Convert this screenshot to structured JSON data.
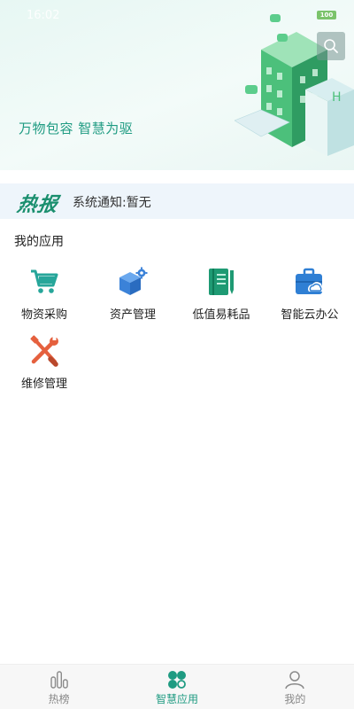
{
  "status": {
    "time": "16:02",
    "battery": "100"
  },
  "banner": {
    "slogan": "万物包容 智慧为驱"
  },
  "news": {
    "logo": "热报",
    "text": "系统通知:暂无"
  },
  "apps_section": {
    "title": "我的应用",
    "items": [
      {
        "label": "物资采购",
        "icon": "shopping-cart-icon",
        "color": "#26a69a"
      },
      {
        "label": "资产管理",
        "icon": "box-gear-icon",
        "color": "#3b82d8"
      },
      {
        "label": "低值易耗品",
        "icon": "notebook-pen-icon",
        "color": "#1e9a73"
      },
      {
        "label": "智能云办公",
        "icon": "briefcase-cloud-icon",
        "color": "#2f7fd4"
      },
      {
        "label": "维修管理",
        "icon": "wrench-screwdriver-icon",
        "color": "#e5603e"
      }
    ]
  },
  "tabbar": {
    "items": [
      {
        "label": "热榜",
        "icon": "bar-chart-icon",
        "active": false
      },
      {
        "label": "智慧应用",
        "icon": "four-leaf-icon",
        "active": true
      },
      {
        "label": "我的",
        "icon": "user-icon",
        "active": false
      }
    ]
  },
  "colors": {
    "accent": "#1f9b82",
    "inactive": "#888888"
  }
}
